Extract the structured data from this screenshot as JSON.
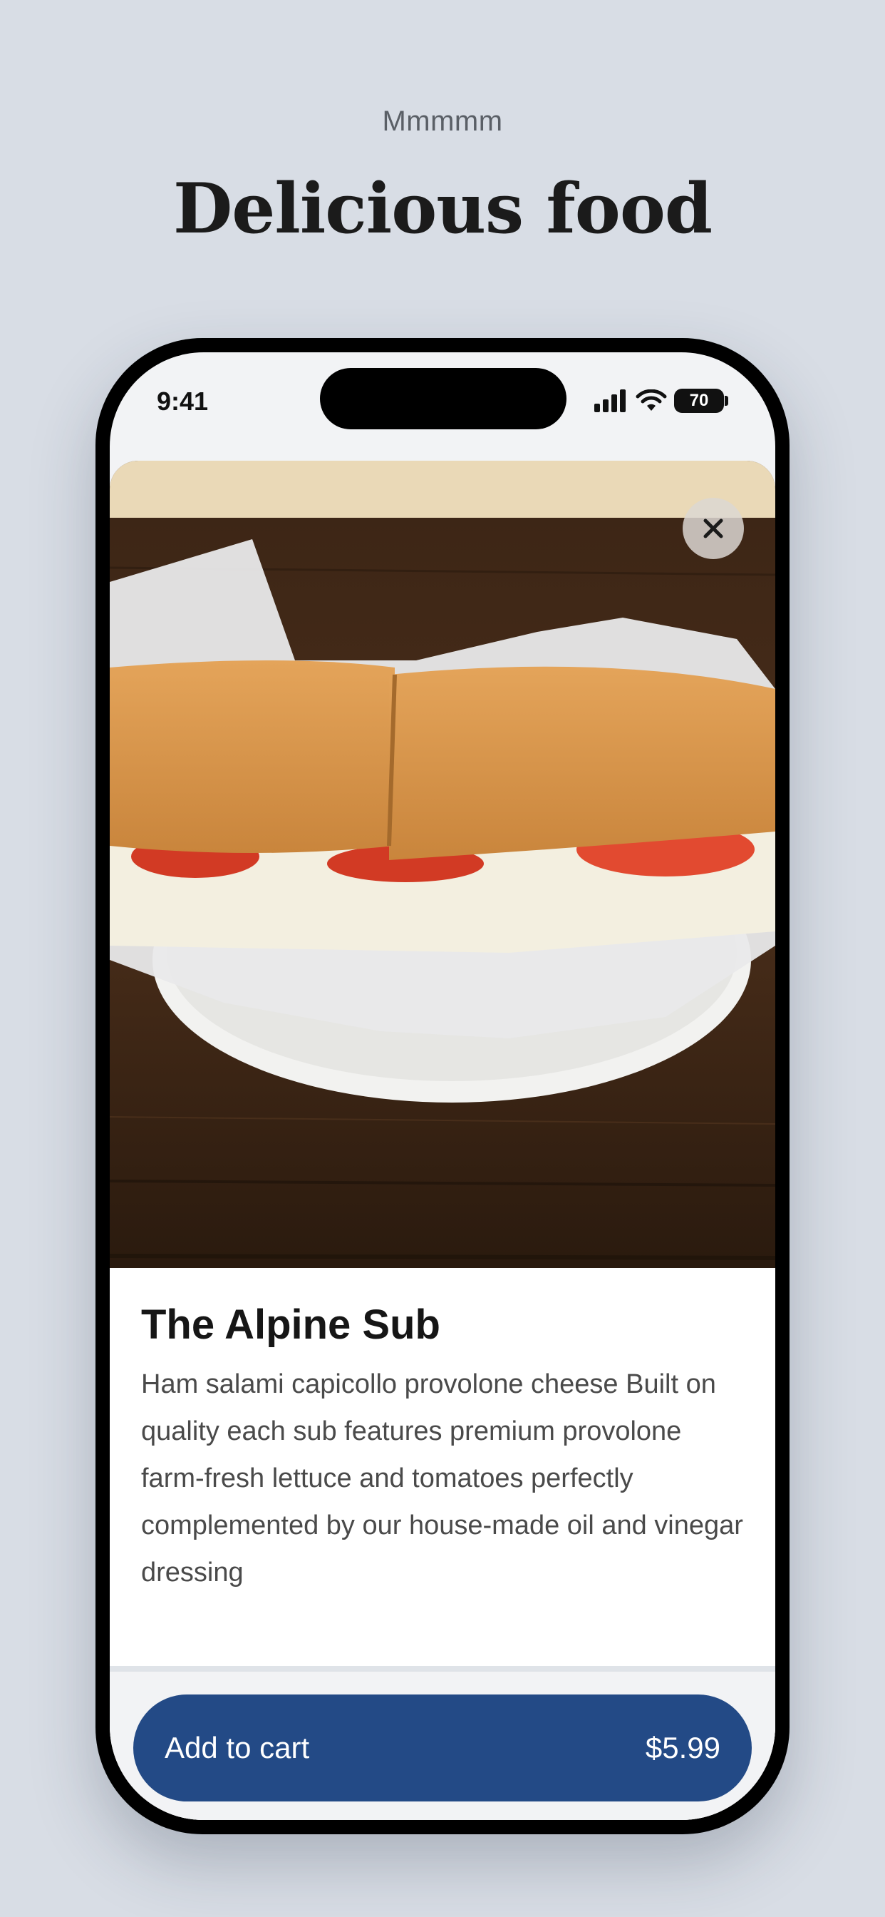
{
  "header": {
    "eyebrow": "Mmmmm",
    "title": "Delicious food"
  },
  "status_bar": {
    "time": "9:41",
    "battery": "70",
    "icons": [
      "signal-icon",
      "wifi-icon",
      "battery-icon"
    ]
  },
  "product": {
    "image_icon": "sandwich-photo",
    "close_icon": "close-icon",
    "name": "The Alpine Sub",
    "description": "Ham salami capicollo provolone cheese Built on quality each sub features premium provolone farm-fresh lettuce and tomatoes perfectly complemented by our house-made oil and vinegar dressing"
  },
  "cart": {
    "label": "Add to cart",
    "price": "$5.99"
  },
  "colors": {
    "background": "#d8dde5",
    "button": "#234a86",
    "text": "#161616"
  }
}
